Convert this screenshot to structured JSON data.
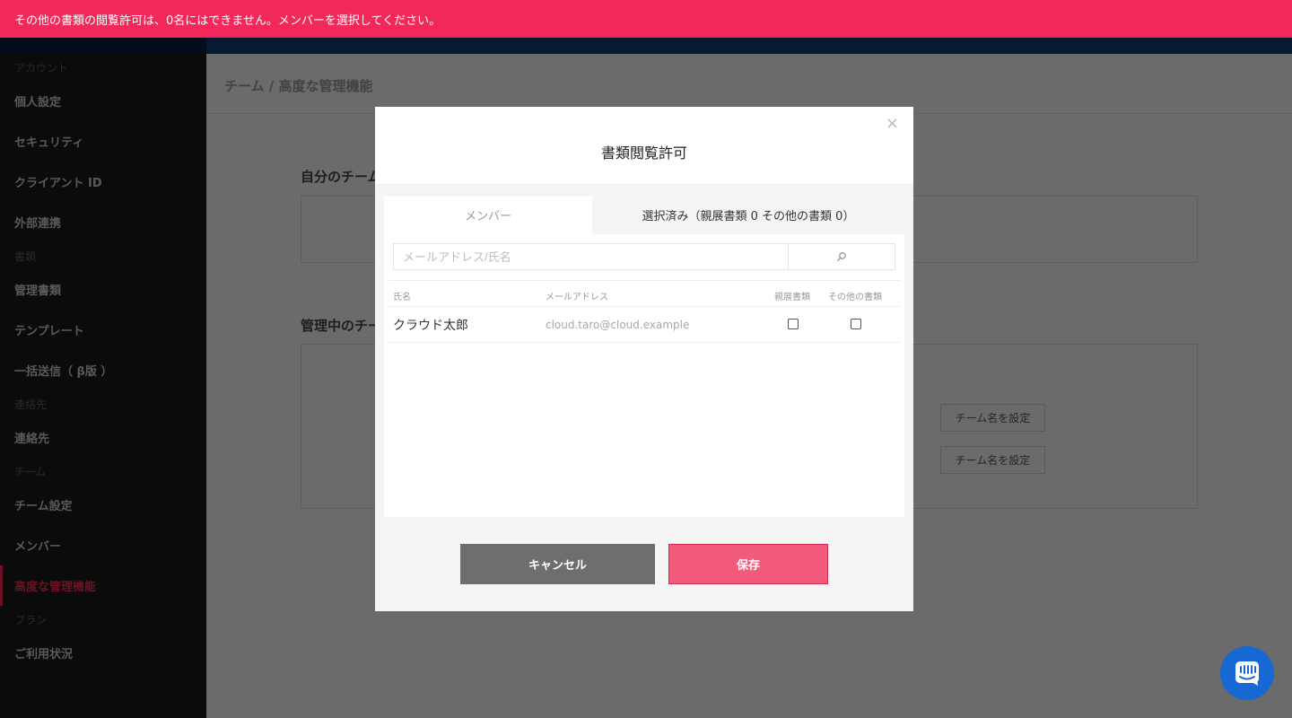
{
  "alert": {
    "message": "その他の書類の閲覧許可は、0名にはできません。メンバーを選択してください。"
  },
  "sidebar": {
    "items": [
      {
        "type": "section",
        "label": "アカウント"
      },
      {
        "type": "item",
        "label": "個人設定"
      },
      {
        "type": "item",
        "label": "セキュリティ"
      },
      {
        "type": "item",
        "label": "クライアント ID"
      },
      {
        "type": "item",
        "label": "外部連携"
      },
      {
        "type": "section",
        "label": "書類"
      },
      {
        "type": "item",
        "label": "管理書類"
      },
      {
        "type": "item",
        "label": "テンプレート"
      },
      {
        "type": "item",
        "label": "一括送信（ β版 ）"
      },
      {
        "type": "section",
        "label": "連絡先"
      },
      {
        "type": "item",
        "label": "連絡先"
      },
      {
        "type": "section",
        "label": "チーム"
      },
      {
        "type": "item",
        "label": "チーム設定"
      },
      {
        "type": "item",
        "label": "メンバー"
      },
      {
        "type": "item",
        "label": "高度な管理機能",
        "active": true
      },
      {
        "type": "section",
        "label": "プラン"
      },
      {
        "type": "item",
        "label": "ご利用状況"
      }
    ]
  },
  "main": {
    "breadcrumb": "チーム / 高度な管理機能",
    "section1_title": "自分のチーム",
    "section2_title": "管理中のチーム",
    "team_name_button_1": "チーム名を設定",
    "team_name_button_2": "チーム名を設定"
  },
  "modal": {
    "title": "書類閲覧許可",
    "close_label": "×",
    "tabs": {
      "members": "メンバー",
      "selected": "選択済み（親展書類 0  その他の書類 0）"
    },
    "search": {
      "placeholder": "メールアドレス/氏名",
      "value": ""
    },
    "table": {
      "headers": {
        "name": "氏名",
        "email": "メールアドレス",
        "parent_docs": "親展書類",
        "other_docs": "その他の書類"
      },
      "rows": [
        {
          "name": "クラウド太郎",
          "email": "cloud.taro@cloud.example",
          "parent_docs": false,
          "other_docs": false
        }
      ]
    },
    "buttons": {
      "cancel": "キャンセル",
      "save": "保存"
    }
  },
  "icons": {
    "search": "search-icon",
    "close": "close-icon",
    "chat": "chat-icon"
  },
  "colors": {
    "alert": "#f2285a",
    "save": "#f25a7a",
    "cancel": "#6e6e6e",
    "chat": "#1668d5"
  }
}
